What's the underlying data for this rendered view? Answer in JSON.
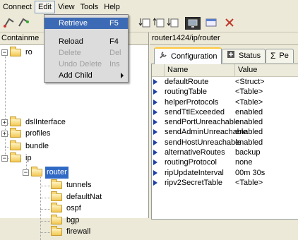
{
  "menubar": {
    "items": [
      {
        "label": "Connect"
      },
      {
        "label": "Edit"
      },
      {
        "label": "View"
      },
      {
        "label": "Tools"
      },
      {
        "label": "Help"
      }
    ]
  },
  "edit_menu": {
    "items": [
      {
        "label": "Retrieve",
        "shortcut": "F5",
        "state": "highlighted"
      },
      {
        "label": "Reload",
        "shortcut": "F4",
        "state": "enabled"
      },
      {
        "label": "Delete",
        "shortcut": "Del",
        "state": "disabled"
      },
      {
        "label": "Undo Delete",
        "shortcut": "Ins",
        "state": "disabled"
      },
      {
        "label": "Add Child",
        "shortcut": "",
        "state": "submenu"
      }
    ]
  },
  "left_panel": {
    "header": "Containme",
    "tree": [
      {
        "label": "ro",
        "expander": "minus"
      },
      {
        "label": "dslInterface",
        "expander": "plus"
      },
      {
        "label": "profiles",
        "expander": "plus"
      },
      {
        "label": "bundle",
        "expander": ""
      },
      {
        "label": "ip",
        "expander": "minus"
      },
      {
        "label": "router",
        "expander": "minus",
        "selected": true
      },
      {
        "label": "tunnels",
        "expander": ""
      },
      {
        "label": "defaultNat",
        "expander": ""
      },
      {
        "label": "ospf",
        "expander": ""
      },
      {
        "label": "bgp",
        "expander": ""
      },
      {
        "label": "firewall",
        "expander": ""
      }
    ]
  },
  "right_panel": {
    "path": "router1424/ip/router",
    "tabs": [
      {
        "label": "Configuration",
        "icon": "wrench-icon",
        "active": true
      },
      {
        "label": "Status",
        "icon": "status-icon",
        "active": false
      },
      {
        "label": "Pe",
        "icon": "sigma-icon",
        "active": false
      }
    ],
    "columns": [
      "Name",
      "Value"
    ],
    "rows": [
      {
        "name": "defaultRoute",
        "value": "<Struct>"
      },
      {
        "name": "routingTable",
        "value": "<Table>"
      },
      {
        "name": "helperProtocols",
        "value": "<Table>"
      },
      {
        "name": "sendTtlExceeded",
        "value": "enabled"
      },
      {
        "name": "sendPortUnreachable",
        "value": "enabled"
      },
      {
        "name": "sendAdminUnreachable",
        "value": "enabled"
      },
      {
        "name": "sendHostUnreachable",
        "value": "enabled"
      },
      {
        "name": "alternativeRoutes",
        "value": "backup"
      },
      {
        "name": "routingProtocol",
        "value": "none"
      },
      {
        "name": "ripUpdateInterval",
        "value": "00m 30s"
      },
      {
        "name": "ripv2SecretTable",
        "value": "<Table>"
      }
    ]
  },
  "colors": {
    "selection": "#316ac5",
    "menu_highlight": "#3d6ab5",
    "row_arrow": "#1d3fa6"
  }
}
